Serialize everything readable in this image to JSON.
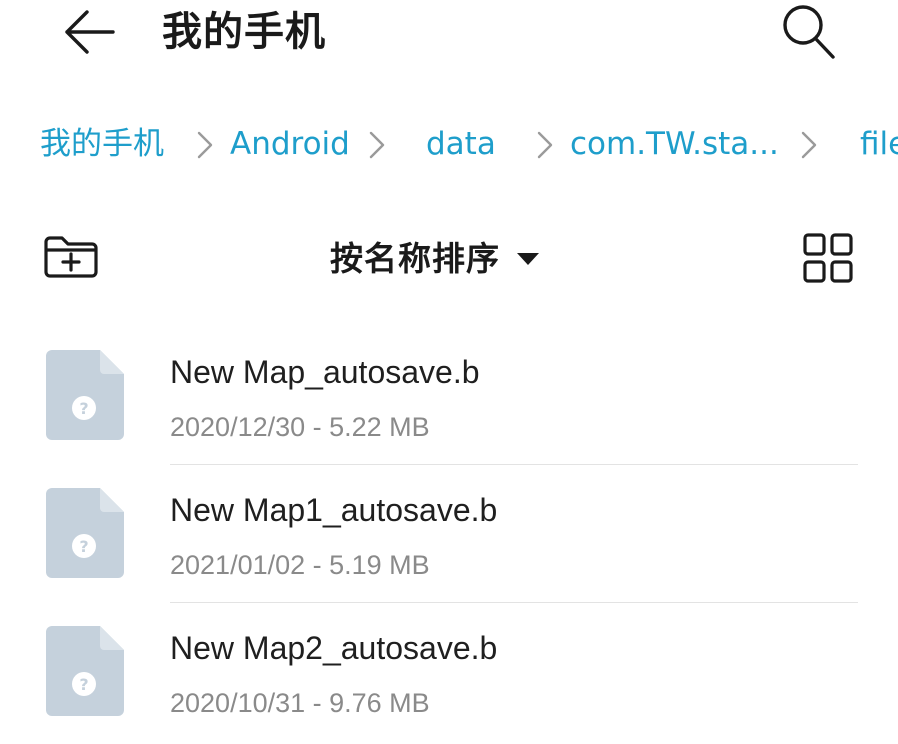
{
  "header": {
    "title": "我的手机"
  },
  "breadcrumb": {
    "items": [
      {
        "label": "我的手机"
      },
      {
        "label": "Android"
      },
      {
        "label": "data"
      },
      {
        "label": "com.TW.sta..."
      },
      {
        "label": "file"
      }
    ]
  },
  "toolbar": {
    "sort_label": "按名称排序"
  },
  "files": [
    {
      "name": "New Map_autosave.b",
      "meta": "2020/12/30 - 5.22 MB"
    },
    {
      "name": "New Map1_autosave.b",
      "meta": "2021/01/02 - 5.19 MB"
    },
    {
      "name": "New Map2_autosave.b",
      "meta": "2020/10/31 - 9.76 MB"
    }
  ],
  "colors": {
    "accent": "#1e9ecb",
    "file_icon": "#c5d1dc",
    "file_icon_fold": "#dbe3ea",
    "meta_text": "#8a8a8a"
  },
  "icons": {
    "back": "arrow-left-icon",
    "search": "search-icon",
    "new_folder": "new-folder-icon",
    "sort_caret": "caret-down-icon",
    "view_toggle": "grid-view-icon",
    "file": "unknown-file-icon"
  }
}
